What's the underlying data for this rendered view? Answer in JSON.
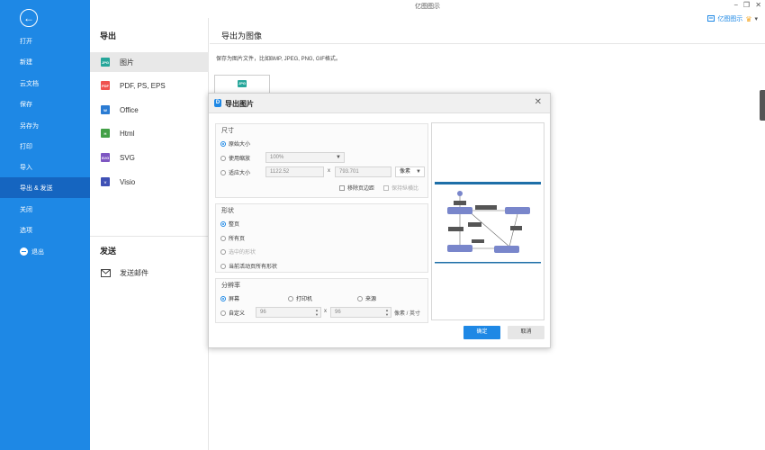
{
  "app": {
    "title": "亿图图示",
    "minimize": "−",
    "restore": "❐",
    "close": "✕",
    "user_name": "亿图图示",
    "user_caret": "▾"
  },
  "nav": {
    "back": "←",
    "items": [
      "打开",
      "新建",
      "云文档",
      "保存",
      "另存为",
      "打印",
      "导入",
      "导出 & 发送",
      "关闭",
      "选项",
      "退出"
    ],
    "active_index": 7
  },
  "sub": {
    "export_title": "导出",
    "formats": [
      {
        "label": "图片",
        "icon": "jpg-icon",
        "icon_text": "JPG",
        "color": "#26a69a"
      },
      {
        "label": "PDF, PS, EPS",
        "icon": "pdf-icon",
        "icon_text": "PDF",
        "color": "#ef5350"
      },
      {
        "label": "Office",
        "icon": "word-icon",
        "icon_text": "W",
        "color": "#2b7cd3"
      },
      {
        "label": "Html",
        "icon": "html-icon",
        "icon_text": "H",
        "color": "#43a047"
      },
      {
        "label": "SVG",
        "icon": "svg-icon",
        "icon_text": "SVG",
        "color": "#7e57c2"
      },
      {
        "label": "Visio",
        "icon": "visio-icon",
        "icon_text": "V",
        "color": "#3f51b5"
      }
    ],
    "send_title": "发送",
    "send_item": "发送邮件"
  },
  "main": {
    "heading": "导出为图像",
    "description": "保存为图片文件，比如BMP, JPEG, PNG, GIF格式。",
    "tile_icon_text": "JPG"
  },
  "dialog": {
    "title": "导出图片",
    "logo": "D",
    "close": "✕",
    "size": {
      "title": "尺寸",
      "original": "原始大小",
      "use_zoom": "使用缩放",
      "zoom_value": "100%",
      "fit": "适应大小",
      "width": "1122.52",
      "x": "x",
      "height": "793.701",
      "unit": "像素",
      "remove_margin": "移除页边距",
      "keep_ratio": "保持纵横比"
    },
    "shape": {
      "title": "形状",
      "whole_page": "整页",
      "all_pages": "所有页",
      "selected": "选中的形状",
      "current_page": "当前活动页所有形状"
    },
    "resolution": {
      "title": "分辨率",
      "screen": "屏幕",
      "printer": "打印机",
      "source": "来源",
      "custom": "自定义",
      "dpi_x": "96",
      "x": "x",
      "dpi_y": "96",
      "unit": "像素 / 英寸"
    },
    "ok": "确定",
    "cancel": "取消"
  },
  "colors": {
    "accent": "#1e88e5",
    "nav_active": "#1565c0",
    "preview_node": "#7986cb",
    "preview_dark_node": "#555555"
  }
}
